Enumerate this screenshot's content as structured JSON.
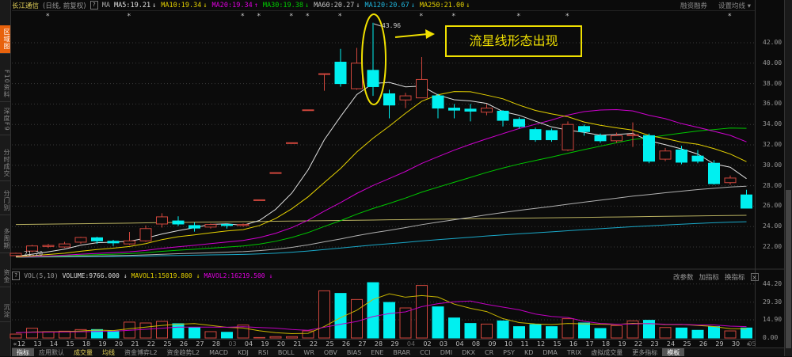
{
  "sidebar": {
    "items": [
      {
        "label": "区域图",
        "active": true
      },
      {
        "label": "F10资料"
      },
      {
        "label": "深度F9"
      },
      {
        "label": "分时成交"
      },
      {
        "label": "分门别"
      },
      {
        "label": "多周期"
      },
      {
        "label": "资金"
      },
      {
        "label": "沉淀"
      }
    ]
  },
  "header": {
    "title": "长江通信",
    "mode": "(日线, 前复权)",
    "help": "?",
    "ma_label": "MA",
    "mas": [
      {
        "text": "MA5:19.21",
        "arrow": "↓",
        "color": "#e0e0e0"
      },
      {
        "text": "MA10:19.34",
        "arrow": "↓",
        "color": "#e6d200"
      },
      {
        "text": "MA20:19.34",
        "arrow": "↑",
        "color": "#e000e0"
      },
      {
        "text": "MA30:19.38",
        "arrow": "↓",
        "color": "#00d000"
      },
      {
        "text": "MA60:20.27",
        "arrow": "↓",
        "color": "#c8c8c8"
      },
      {
        "text": "MA120:20.67",
        "arrow": "↓",
        "color": "#20b8e0"
      },
      {
        "text": "MA250:21.00",
        "arrow": "↓",
        "color": "#e6d200"
      }
    ],
    "margin_trading": "融资融券",
    "set_ma": "设置均线 ▾"
  },
  "annotation": {
    "text": "流星线形态出现",
    "peak_label": "43.96",
    "low_label": "21.20"
  },
  "price_axis": [
    "42.00",
    "40.00",
    "38.00",
    "36.00",
    "34.00",
    "32.00",
    "30.00",
    "28.00",
    "26.00",
    "24.00",
    "22.00"
  ],
  "volume_header": {
    "help": "?",
    "name": "VOL(5,10)",
    "volume": "VOLUME:9766.000",
    "volume_arrow": "↓",
    "mavol1": "MAVOL1:15019.800",
    "mavol1_arrow": "↓",
    "mavol2": "MAVOL2:16219.500",
    "mavol2_arrow": "↓",
    "btn_params": "改参数",
    "btn_add": "加指标",
    "btn_switch": "换指标",
    "btn_close": "×"
  },
  "volume_axis": [
    "44.20",
    "29.30",
    "14.90",
    "0.00"
  ],
  "nav": {
    "prev": "«",
    "next": "»"
  },
  "tabs": [
    "指标",
    "应用默认",
    "成交量",
    "均线",
    "资金博弈L2",
    "资金趋势L2",
    "MACD",
    "KDJ",
    "RSI",
    "BOLL",
    "WR",
    "OBV",
    "BIAS",
    "ENE",
    "BRAR",
    "CCI",
    "DMI",
    "DKX",
    "CR",
    "PSY",
    "KD",
    "DMA",
    "TRIX",
    "虚拟成交量",
    "更多指标",
    "模板"
  ],
  "colors": {
    "up": "#d0463c",
    "down": "#00f0f0",
    "ma5": "#e0e0e0",
    "ma10": "#e6d200",
    "ma20": "#d000d0",
    "ma30": "#00c800",
    "ma60": "#b0b0b0",
    "ma120": "#1aa8c8",
    "ma250": "#b8b060",
    "accent": "#f0e000"
  },
  "chart_data": {
    "type": "candlestick",
    "dates": [
      "12",
      "13",
      "14",
      "15",
      "18",
      "19",
      "20",
      "21",
      "22",
      "25",
      "26",
      "27",
      "28",
      "03",
      "04",
      "19",
      "20",
      "21",
      "22",
      "25",
      "26",
      "27",
      "28",
      "29",
      "04",
      "02",
      "03",
      "04",
      "08",
      "09",
      "10",
      "11",
      "12",
      "15",
      "16",
      "17",
      "18",
      "19",
      "22",
      "23",
      "24",
      "25",
      "26",
      "29",
      "30",
      "05"
    ],
    "grey_dates": [
      13,
      24,
      45
    ],
    "open": [
      21.15,
      21.6,
      22.05,
      22.0,
      22.47,
      22.9,
      22.56,
      22.3,
      22.6,
      24.25,
      24.55,
      24.1,
      23.95,
      24.2,
      24.1,
      26.6,
      29.28,
      32.21,
      35.43,
      38.97,
      40.1,
      37.5,
      39.3,
      37.0,
      36.4,
      36.6,
      36.8,
      35.6,
      35.5,
      35.2,
      35.3,
      34.5,
      33.5,
      33.4,
      31.5,
      33.8,
      32.9,
      32.4,
      32.9,
      32.9,
      30.6,
      31.5,
      30.9,
      30.2,
      28.3,
      27.1
    ],
    "close": [
      21.38,
      22.1,
      22.15,
      22.3,
      22.93,
      22.6,
      22.4,
      22.6,
      23.8,
      24.95,
      24.25,
      23.85,
      24.2,
      24.1,
      24.2,
      26.62,
      29.28,
      32.21,
      35.43,
      38.97,
      38.0,
      40.0,
      37.7,
      35.9,
      36.8,
      38.4,
      35.6,
      35.4,
      35.3,
      35.6,
      34.4,
      33.8,
      32.5,
      32.5,
      34.0,
      33.3,
      32.4,
      32.9,
      33.0,
      30.4,
      31.4,
      30.3,
      30.4,
      28.2,
      28.75,
      25.8
    ],
    "high": [
      21.45,
      22.2,
      22.3,
      22.5,
      23.0,
      23.0,
      22.7,
      23.47,
      24.1,
      25.3,
      25.0,
      24.4,
      24.3,
      24.3,
      24.3,
      26.62,
      29.28,
      32.21,
      35.43,
      38.97,
      41.4,
      41.5,
      43.96,
      37.4,
      37.1,
      40.6,
      37.0,
      36.0,
      36.0,
      36.0,
      35.4,
      34.7,
      33.7,
      33.6,
      34.3,
      34.0,
      33.1,
      33.2,
      34.2,
      33.1,
      31.7,
      31.9,
      31.5,
      30.5,
      29.0,
      27.6
    ],
    "low": [
      21.2,
      21.5,
      21.9,
      21.9,
      22.3,
      22.3,
      22.1,
      22.2,
      22.5,
      23.9,
      24.05,
      23.5,
      23.8,
      23.8,
      24.0,
      26.6,
      29.28,
      32.21,
      35.43,
      37.3,
      37.7,
      37.4,
      36.8,
      34.6,
      35.6,
      36.6,
      34.6,
      34.6,
      34.3,
      34.9,
      33.8,
      33.6,
      32.3,
      32.3,
      31.4,
      32.9,
      32.2,
      32.2,
      31.8,
      30.2,
      30.4,
      30.1,
      30.2,
      28.1,
      28.1,
      25.8
    ],
    "volume": [
      3.2,
      8.0,
      5.2,
      5.6,
      6.9,
      6.9,
      5.6,
      13.0,
      12.3,
      13.6,
      11.7,
      8.6,
      5.2,
      4.7,
      10.6,
      0.4,
      1.1,
      1.1,
      5.8,
      38.6,
      36.5,
      31.5,
      45.3,
      29.1,
      24.6,
      43.0,
      25.5,
      16.4,
      11.9,
      11.4,
      14.0,
      9.3,
      11.0,
      9.3,
      15.8,
      12.3,
      7.8,
      10.1,
      14.0,
      14.5,
      8.6,
      8.2,
      6.3,
      9.3,
      5.8,
      8.2
    ],
    "ma250_range": [
      24.2,
      25.1
    ],
    "history_pad_price": 21.0,
    "history_pad_volume": 4.5,
    "event_markers": [
      2,
      7,
      14,
      15,
      17,
      18,
      20,
      25,
      27,
      31,
      34,
      44
    ],
    "price_ylim": [
      21,
      43.5
    ],
    "volume_ylim": [
      0,
      44.2
    ]
  }
}
